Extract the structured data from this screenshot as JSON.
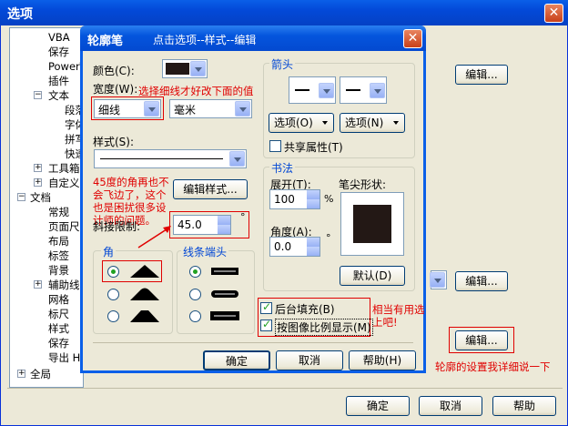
{
  "outer": {
    "title": "选项",
    "tree": [
      "VBA",
      "保存",
      "PowerT",
      "插件",
      "文本",
      "段落",
      "字体",
      "拼写",
      "快速",
      "工具箱",
      "自定义",
      "文档",
      "常规",
      "页面尺",
      "布局",
      "标签",
      "背景",
      "辅助线",
      "网格",
      "标尺",
      "样式",
      "保存",
      "导出 H",
      "全局"
    ],
    "edit_label": "编辑...",
    "ok": "确定",
    "cancel": "取消",
    "help": "帮助"
  },
  "dialog": {
    "title": "轮廓笔",
    "subtitle": "点击选项--样式--编辑",
    "color_label": "颜色(C):",
    "width_label": "宽度(W):",
    "width_value": "细线",
    "unit_value": "毫米",
    "style_label": "样式(S):",
    "edit_style_btn": "编辑样式...",
    "miter_label": "斜接限制:",
    "miter_value": "45.0",
    "degree": "°",
    "corners_label": "角",
    "linecaps_label": "线条端头",
    "arrows_label": "箭头",
    "options_left": "选项(O)",
    "options_right": "选项(N)",
    "share_attr": "共享属性(T)",
    "calligraphy_label": "书法",
    "stretch_label": "展开(T):",
    "stretch_value": "100",
    "percent": "%",
    "nib_label": "笔尖形状:",
    "angle_label": "角度(A):",
    "angle_value": "0.0",
    "default_btn": "默认(D)",
    "behind_fill": "后台填充(B)",
    "scale_with_image": "按图像比例显示(M)",
    "ok": "确定",
    "cancel": "取消",
    "help": "帮助(H)"
  },
  "notes": {
    "width_note": "选择细线才好改下面的值",
    "miter_note": "45度的角再也不会飞边了，这个也是困扰很多设计师的问题。",
    "useful_note": "相当有用选上吧!",
    "outline_note": "轮廓的设置我详细说一下"
  },
  "colors": {
    "accent_red": "#e00000",
    "title_blue": "#0349d8",
    "group_label": "#0046d5"
  }
}
